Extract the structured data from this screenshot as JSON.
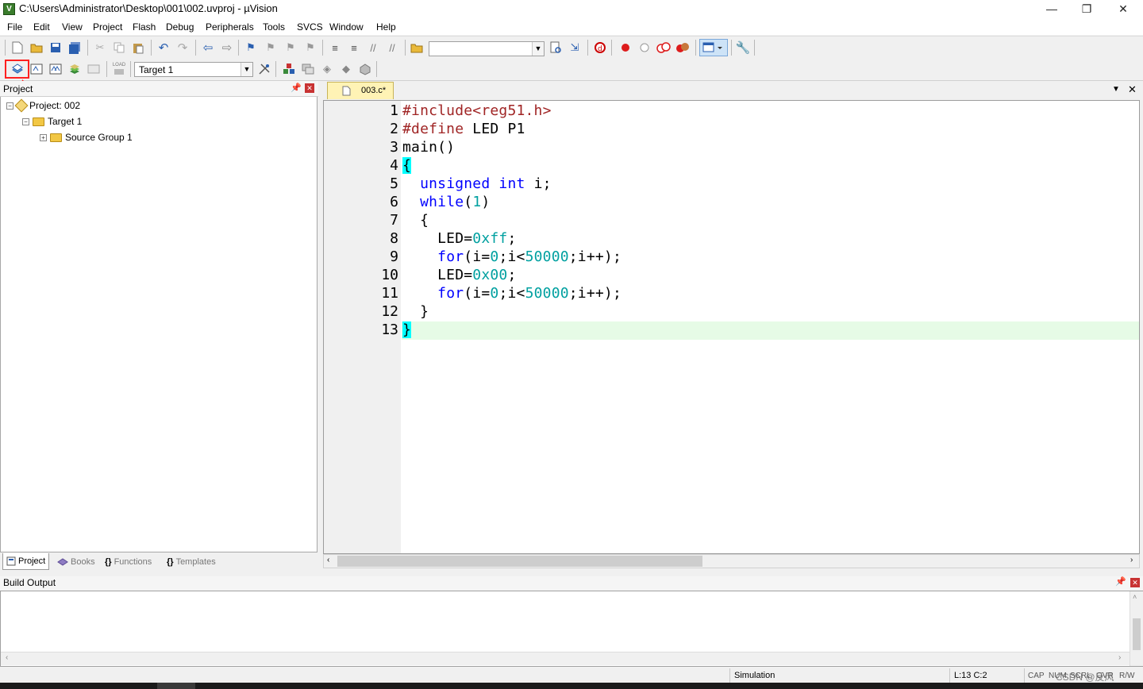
{
  "window": {
    "title": "C:\\Users\\Administrator\\Desktop\\001\\002.uvproj - µVision",
    "app_icon": "V",
    "minimize": "—",
    "restore": "❐",
    "close": "✕"
  },
  "menu": [
    "File",
    "Edit",
    "View",
    "Project",
    "Flash",
    "Debug",
    "Peripherals",
    "Tools",
    "SVCS",
    "Window",
    "Help"
  ],
  "toolbar2": {
    "target_combo": "Target 1",
    "load_label": "LOAD"
  },
  "project_panel": {
    "title": "Project",
    "tree": {
      "project": "Project: 002",
      "target": "Target 1",
      "group": "Source Group 1"
    },
    "tabs": [
      "Project",
      "Books",
      "Functions",
      "Templates"
    ]
  },
  "editor": {
    "tab_label": "003.c*",
    "line_numbers": [
      "1",
      "2",
      "3",
      "4",
      "5",
      "6",
      "7",
      "8",
      "9",
      "10",
      "11",
      "12",
      "13"
    ]
  },
  "build_output": {
    "title": "Build Output"
  },
  "statusbar": {
    "mode": "Simulation",
    "position": "L:13 C:2",
    "caps": "CAP",
    "num": "NUM",
    "scrl": "SCRL",
    "ovr": "OVR",
    "rw": "R/W",
    "watermark": "CSDN @反风"
  },
  "colors": {
    "annotation": "#ff2020",
    "keyword": "#0000ff",
    "number": "#00a0a0",
    "preprocessor": "#a02525",
    "current_line": "#e6fbe6",
    "tab_active": "#fff3b5"
  }
}
